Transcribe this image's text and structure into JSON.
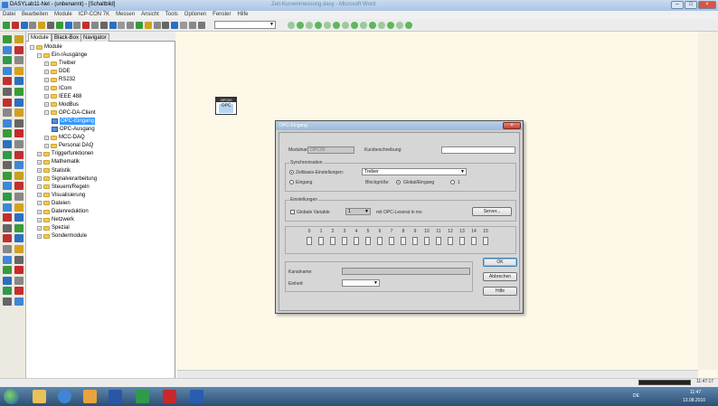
{
  "window": {
    "title": "DASYLab11-Net - (unbenannt) - [Schaltbild]",
    "ghost_title": "Zeit-Kurvenmessung.dasy - Microsoft Word"
  },
  "menu": [
    "Datei",
    "Bearbeiten",
    "Module",
    "ICP-CON 7K",
    "Messen",
    "Ansicht",
    "Tools",
    "Optionen",
    "Fenster",
    "Hilfe"
  ],
  "panel": {
    "tabs": [
      "Module",
      "Black-Box",
      "Navigator"
    ],
    "tree": [
      {
        "label": "Module",
        "level": 0,
        "kind": "folder",
        "expanded": true
      },
      {
        "label": "Ein-/Ausgänge",
        "level": 1,
        "kind": "folder",
        "expanded": true
      },
      {
        "label": "Treiber",
        "level": 2,
        "kind": "folder"
      },
      {
        "label": "DDE",
        "level": 2,
        "kind": "folder"
      },
      {
        "label": "RS232",
        "level": 2,
        "kind": "folder"
      },
      {
        "label": "ICom",
        "level": 2,
        "kind": "folder"
      },
      {
        "label": "IEEE 488",
        "level": 2,
        "kind": "folder"
      },
      {
        "label": "ModBus",
        "level": 2,
        "kind": "folder"
      },
      {
        "label": "OPC-DA-Client",
        "level": 2,
        "kind": "folder",
        "expanded": true
      },
      {
        "label": "OPC-Eingang",
        "level": 3,
        "kind": "module",
        "selected": true
      },
      {
        "label": "OPC-Ausgang",
        "level": 3,
        "kind": "module"
      },
      {
        "label": "MCC-DAQ",
        "level": 2,
        "kind": "folder"
      },
      {
        "label": "Personal DAQ",
        "level": 2,
        "kind": "folder"
      },
      {
        "label": "Triggerfunktionen",
        "level": 1,
        "kind": "folder"
      },
      {
        "label": "Mathematik",
        "level": 1,
        "kind": "folder"
      },
      {
        "label": "Statistik",
        "level": 1,
        "kind": "folder"
      },
      {
        "label": "Signalverarbeitung",
        "level": 1,
        "kind": "folder"
      },
      {
        "label": "Steuern/Regeln",
        "level": 1,
        "kind": "folder"
      },
      {
        "label": "Visualisierung",
        "level": 1,
        "kind": "folder"
      },
      {
        "label": "Dateien",
        "level": 1,
        "kind": "folder"
      },
      {
        "label": "Datenreduktion",
        "level": 1,
        "kind": "folder"
      },
      {
        "label": "Netzwerk",
        "level": 1,
        "kind": "folder"
      },
      {
        "label": "Spezial",
        "level": 1,
        "kind": "folder"
      },
      {
        "label": "Sondermodule",
        "level": 1,
        "kind": "folder"
      }
    ]
  },
  "canvas_block": {
    "header": "OPC00",
    "body": "OPC"
  },
  "dialog": {
    "title": "OPC-Eingang",
    "modulname_label": "Modulname:",
    "modulname_value": "OPC00",
    "kurzbeschreibung_label": "Kurzbeschreibung:",
    "kurzbeschreibung_value": "",
    "sync_group": "Synchronisation",
    "zeitbasis_label": "Zeitbasis-Einstellungen:",
    "eingang_label": "Eingang",
    "treiber_value": "Treiber",
    "blockgroesse_label": "Blockgröße:",
    "global_eingang_label": "Global/Eingang",
    "one_label": "1",
    "einstellungen_group": "Einstellungen",
    "globale_variable_label": "Globale Variable",
    "interval_value": "1",
    "interval_label": "mit OPC-Leserat in ms",
    "server_button": "Server...",
    "channels": [
      "0",
      "1",
      "2",
      "3",
      "4",
      "5",
      "6",
      "7",
      "8",
      "9",
      "10",
      "11",
      "12",
      "13",
      "14",
      "15"
    ],
    "kanalname_label": "Kanalname:",
    "einheit_label": "Einheit:",
    "ok_button": "OK",
    "abbrechen_button": "Abbrechen",
    "hilfe_button": "Hilfe"
  },
  "tray": {
    "lang": "DE",
    "time": "11:47",
    "date": "13.08.2010"
  },
  "statusbar": {
    "time": "11:47:17"
  },
  "taskbar_apps": [
    "windows-explorer",
    "internet-explorer",
    "outlook",
    "dasylab",
    "excel",
    "acrobat",
    "word"
  ]
}
